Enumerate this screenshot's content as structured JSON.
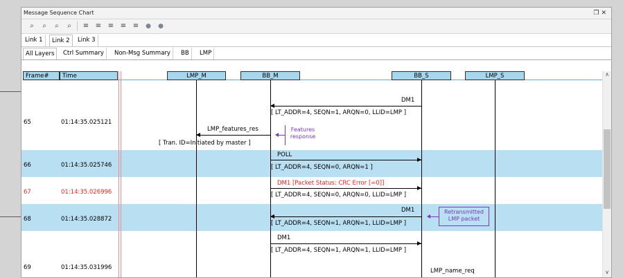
{
  "window": {
    "title": "Message Sequence Chart",
    "controls": "  ✕"
  },
  "toolbar": {
    "icons": [
      "zoom-in-icon",
      "zoom-out-icon",
      "zoom-fit-icon",
      "zoom-reset-icon",
      "filter-icon",
      "filter-msg-icon",
      "filter-ctrl-icon",
      "filter-data-icon",
      "filter-layer-icon",
      "prev-circle-icon",
      "next-circle-icon"
    ]
  },
  "link_tabs": [
    "Link 1",
    "Link 2",
    "Link 3"
  ],
  "layer_tabs": [
    "All Layers",
    "Ctrl Summary",
    "Non-Msg Summary",
    "BB",
    "LMP"
  ],
  "headers": {
    "frame": "Frame#",
    "time": "Time",
    "lanes": [
      "LMP_M",
      "BB_M",
      "BB_S",
      "LMP_S"
    ]
  },
  "rows": [
    {
      "frame": "65",
      "time": "01:14:35.025121",
      "error": false
    },
    {
      "frame": "66",
      "time": "01:14:35.025746",
      "error": false
    },
    {
      "frame": "67",
      "time": "01:14:35.026996",
      "error": true
    },
    {
      "frame": "68",
      "time": "01:14:35.028872",
      "error": false
    },
    {
      "frame": "69",
      "time": "01:14:35.031996",
      "error": false
    }
  ],
  "messages": {
    "dm1_top": "DM1",
    "dm1_top_detail": "[ LT_ADDR=4, SEQN=1, ARQN=0, LLID=LMP ]",
    "lmp_features_res": "LMP_features_res",
    "lmp_features_res_detail": "[ Tran. ID=Initiated by master ]",
    "poll": "POLL",
    "poll_detail": "[ LT_ADDR=4, SEQN=0, ARQN=1 ]",
    "dm1_error": "DM1 [Packet Status: CRC Error [=0]]",
    "dm1_error_detail": "[ LT_ADDR=4, SEQN=0, ARQN=0, LLID=LMP ]",
    "dm1_retx": "DM1",
    "dm1_retx_detail": "[ LT_ADDR=4, SEQN=1, ARQN=1, LLID=LMP ]",
    "dm1_last": "DM1",
    "dm1_last_detail": "[ LT_ADDR=4, SEQN=1, ARQN=1, LLID=LMP ]",
    "lmp_name_req": "LMP_name_req"
  },
  "annotations": {
    "features_response": "Features response",
    "retransmitted": "Retransmitted LMP packet"
  },
  "colors": {
    "row_highlight": "#b9dff2",
    "header_bg": "#a8d6ec",
    "error_text": "#e22222",
    "annotation": "#7a37c2"
  }
}
